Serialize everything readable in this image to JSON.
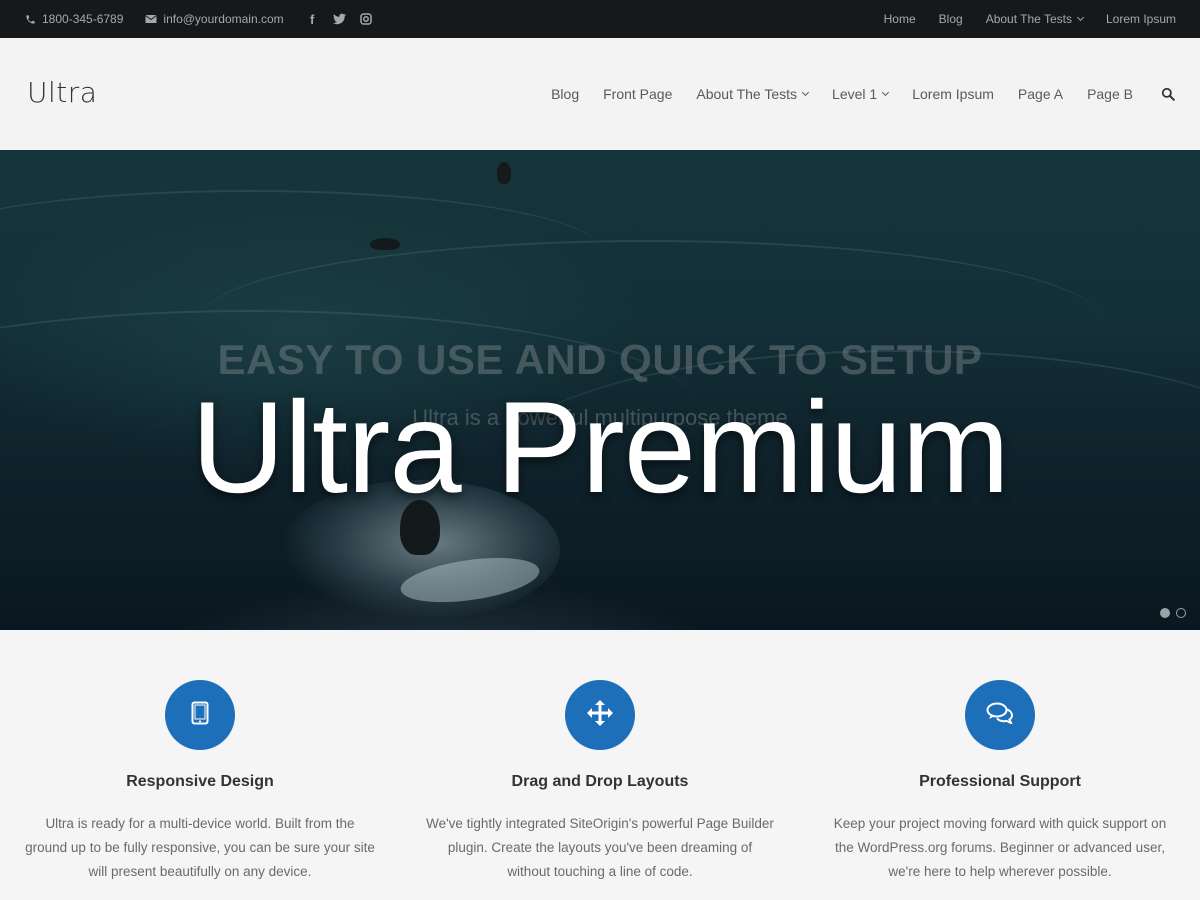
{
  "topbar": {
    "phone": "1800-345-6789",
    "email": "info@yourdomain.com",
    "social": [
      "facebook-icon",
      "twitter-icon",
      "instagram-icon"
    ],
    "links": [
      {
        "label": "Home"
      },
      {
        "label": "Blog"
      },
      {
        "label": "About The Tests",
        "has_dropdown": true
      },
      {
        "label": "Lorem Ipsum"
      }
    ]
  },
  "header": {
    "logo": "Ultra",
    "nav": [
      {
        "label": "Blog"
      },
      {
        "label": "Front Page"
      },
      {
        "label": "About The Tests",
        "has_dropdown": true
      },
      {
        "label": "Level 1",
        "has_dropdown": true
      },
      {
        "label": "Lorem Ipsum"
      },
      {
        "label": "Page A"
      },
      {
        "label": "Page B"
      }
    ],
    "search_icon": "search-icon"
  },
  "hero": {
    "heading": "EASY TO USE AND QUICK TO SETUP",
    "subheading": "Ultra is a powerful multipurpose theme",
    "overlay_title": "Ultra Premium",
    "slides": 2,
    "active_slide": 1
  },
  "features": [
    {
      "icon": "tablet-icon",
      "title": "Responsive Design",
      "text": "Ultra is ready for a multi-device world. Built from the ground up to be fully responsive, you can be sure your site will present beautifully on any device."
    },
    {
      "icon": "move-arrows-icon",
      "title": "Drag and Drop Layouts",
      "text": "We've tightly integrated SiteOrigin's powerful Page Builder plugin. Create the layouts you've been dreaming of without touching a line of code."
    },
    {
      "icon": "chat-bubbles-icon",
      "title": "Professional Support",
      "text": "Keep your project moving forward with quick support on the WordPress.org forums. Beginner or advanced user, we're here to help wherever possible."
    }
  ],
  "colors": {
    "accent": "#1c6fb8",
    "topbar_bg": "#15191c",
    "header_bg": "#f3f3f3"
  }
}
